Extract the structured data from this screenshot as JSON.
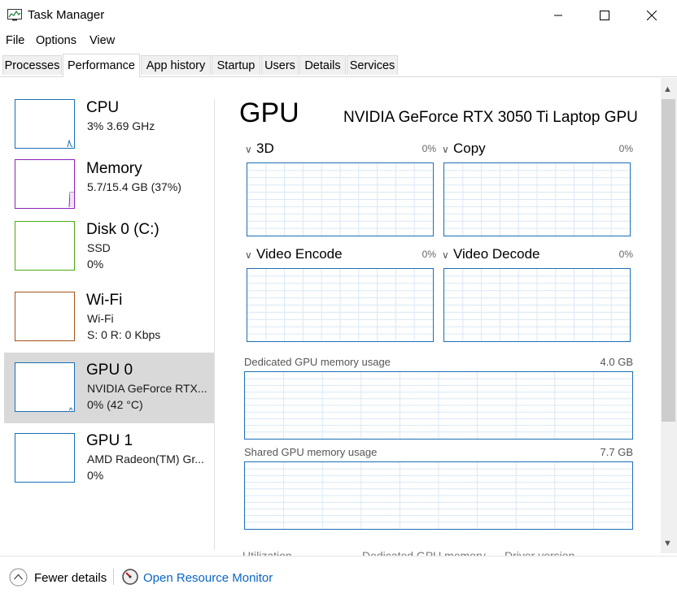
{
  "window": {
    "title": "Task Manager"
  },
  "menu": [
    "File",
    "Options",
    "View"
  ],
  "tabs": [
    "Processes",
    "Performance",
    "App history",
    "Startup",
    "Users",
    "Details",
    "Services"
  ],
  "active_tab": "Performance",
  "sidebar": [
    {
      "title": "CPU",
      "line1": "3%  3.69 GHz",
      "line2": "",
      "color": "#1b6fb7"
    },
    {
      "title": "Memory",
      "line1": "5.7/15.4 GB (37%)",
      "line2": "",
      "color": "#8b22b5"
    },
    {
      "title": "Disk 0 (C:)",
      "line1": "SSD",
      "line2": "0%",
      "color": "#4caa14"
    },
    {
      "title": "Wi-Fi",
      "line1": "Wi-Fi",
      "line2": "S: 0  R: 0 Kbps",
      "color": "#a4541c"
    },
    {
      "title": "GPU 0",
      "line1": "NVIDIA GeForce RTX...",
      "line2": "0%  (42 °C)",
      "color": "#1b6fb7"
    },
    {
      "title": "GPU 1",
      "line1": "AMD Radeon(TM) Gr...",
      "line2": "0%",
      "color": "#1b6fb7"
    }
  ],
  "main": {
    "title": "GPU",
    "model": "NVIDIA GeForce RTX 3050 Ti Laptop GPU",
    "engines": [
      {
        "label": "3D",
        "percent": "0%"
      },
      {
        "label": "Copy",
        "percent": "0%"
      },
      {
        "label": "Video Encode",
        "percent": "0%"
      },
      {
        "label": "Video Decode",
        "percent": "0%"
      }
    ],
    "dedicated": {
      "label": "Dedicated GPU memory usage",
      "max": "4.0 GB"
    },
    "shared": {
      "label": "Shared GPU memory usage",
      "max": "7.7 GB"
    },
    "cutoff_labels": [
      "Utilization",
      "Dedicated GPU memory",
      "Driver version"
    ]
  },
  "footer": {
    "fewer_details": "Fewer details",
    "open_resource_monitor": "Open Resource Monitor"
  },
  "colors": {
    "accent_blue": "#1b6fb7",
    "grid": "#d9e8f5",
    "link": "#0a64c8"
  }
}
